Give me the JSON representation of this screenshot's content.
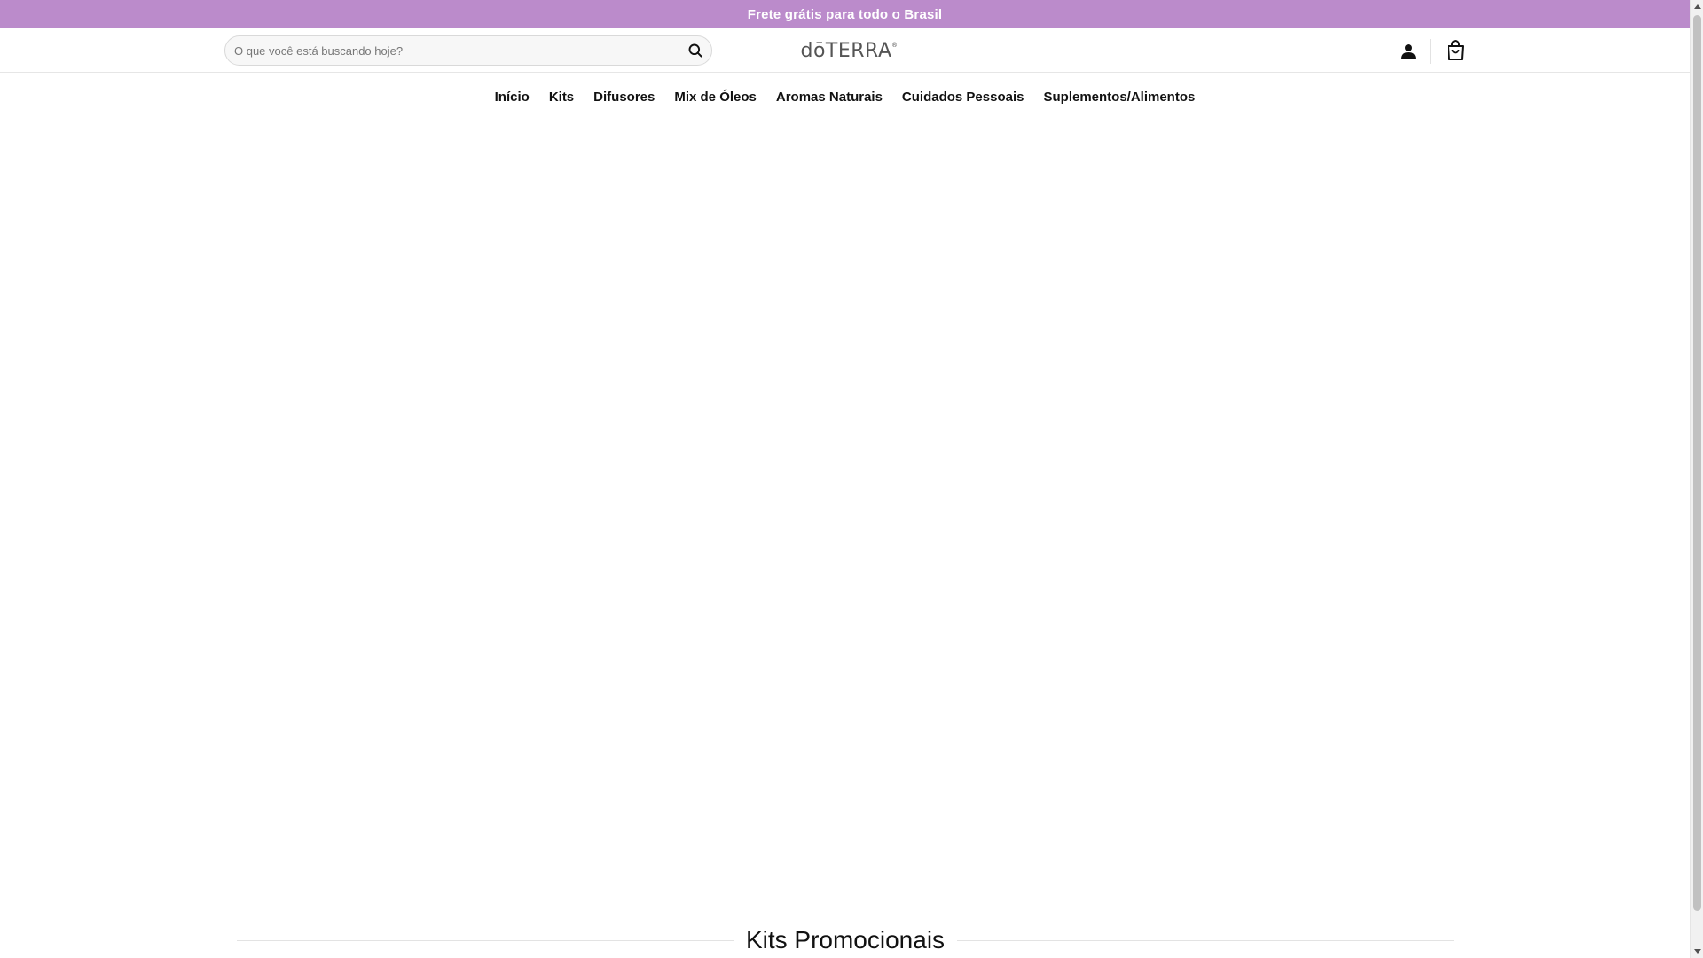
{
  "announcement": {
    "text": "Frete grátis para todo o Brasil"
  },
  "header": {
    "search": {
      "placeholder": "O que você está buscando hoje?",
      "value": ""
    },
    "logo": {
      "text": "dōTERRA",
      "reg_mark": "®"
    },
    "icons": {
      "search": "search-icon",
      "account": "user-icon",
      "cart": "shopping-bag-icon"
    }
  },
  "nav": {
    "items": [
      {
        "label": "Início"
      },
      {
        "label": "Kits"
      },
      {
        "label": "Difusores"
      },
      {
        "label": "Mix de Óleos"
      },
      {
        "label": "Aromas Naturais"
      },
      {
        "label": "Cuidados Pessoais"
      },
      {
        "label": "Suplementos/Alimentos"
      }
    ]
  },
  "sections": [
    {
      "title": "Kits Promocionais"
    }
  ],
  "colors": {
    "announcement_bg": "#bb8bcb",
    "announcement_text": "#ffffff",
    "text": "#111111",
    "border": "#e6e6e6"
  }
}
